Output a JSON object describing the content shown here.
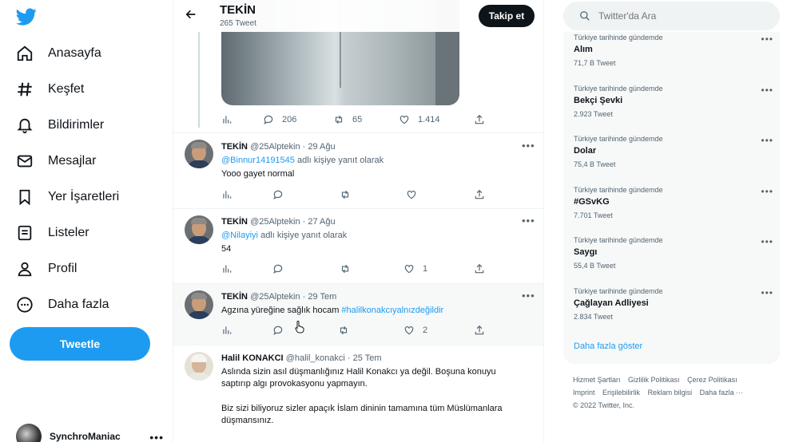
{
  "nav": {
    "items": [
      {
        "label": "Anasayfa"
      },
      {
        "label": "Keşfet"
      },
      {
        "label": "Bildirimler"
      },
      {
        "label": "Mesajlar"
      },
      {
        "label": "Yer İşaretleri"
      },
      {
        "label": "Listeler"
      },
      {
        "label": "Profil"
      },
      {
        "label": "Daha fazla"
      }
    ],
    "tweet_button": "Tweetle",
    "account_name": "SynchroManiac",
    "account_more": "•••"
  },
  "header": {
    "title": "TEKİN",
    "subtitle": "265 Tweet",
    "follow_label": "Takip et"
  },
  "top_tweet_stats": {
    "replies": "206",
    "retweets": "65",
    "likes": "1.414"
  },
  "tweets": [
    {
      "name": "TEKİN",
      "meta": "@25Alptekin · 29 Ağu",
      "reply_handle": "@Binnur14191545",
      "reply_suffix": " adlı kişiye yanıt olarak",
      "text": "Yooo gayet normal",
      "likes": ""
    },
    {
      "name": "TEKİN",
      "meta": "@25Alptekin · 27 Ağu",
      "reply_handle": "@Nilayiyi",
      "reply_suffix": " adlı kişiye yanıt olarak",
      "text": "54",
      "likes": "1"
    },
    {
      "name": "TEKİN",
      "meta": "@25Alptekin · 29 Tem",
      "text_before": "Agzına yüreğine sağlık hocam ",
      "hashtag": "#halilkonakcıyalnızdeğildir",
      "likes": "2"
    },
    {
      "name": "Halil KONAKCI",
      "meta": "@halil_konakci · 25 Tem",
      "paragraph1": "Aslında sizin asıl düşmanlığınız Halil Konakcı ya değil. Boşuna konuyu saptırıp algı provokasyonu yapmayın.",
      "paragraph2": "Biz sizi biliyoruz sizler apaçık İslam dininin tamamına tüm Müslümanlara düşmansınız."
    }
  ],
  "dots": "•••",
  "search": {
    "placeholder": "Twitter'da Ara"
  },
  "trends": {
    "items": [
      {
        "context": "Türkiye tarihinde gündemde",
        "name": "Alım",
        "count": "71,7 B Tweet"
      },
      {
        "context": "Türkiye tarihinde gündemde",
        "name": "Bekçi Şevki",
        "count": "2.923 Tweet"
      },
      {
        "context": "Türkiye tarihinde gündemde",
        "name": "Dolar",
        "count": "75,4 B Tweet"
      },
      {
        "context": "Türkiye tarihinde gündemde",
        "name": "#GSvKG",
        "count": "7.701 Tweet"
      },
      {
        "context": "Türkiye tarihinde gündemde",
        "name": "Saygı",
        "count": "55,4 B Tweet"
      },
      {
        "context": "Türkiye tarihinde gündemde",
        "name": "Çağlayan Adliyesi",
        "count": "2.834 Tweet"
      }
    ],
    "show_more": "Daha fazla göster"
  },
  "footer": {
    "links": [
      "Hizmet Şartları",
      "Gizlilik Politikası",
      "Çerez Politikası",
      "Imprint",
      "Erişilebilirlik",
      "Reklam bilgisi",
      "Daha fazla ···"
    ],
    "copyright": "© 2022 Twitter, Inc."
  },
  "colors": {
    "accent": "#1d9bf0",
    "text": "#0f1419",
    "muted": "#536471",
    "panel": "#f7f9f9"
  }
}
